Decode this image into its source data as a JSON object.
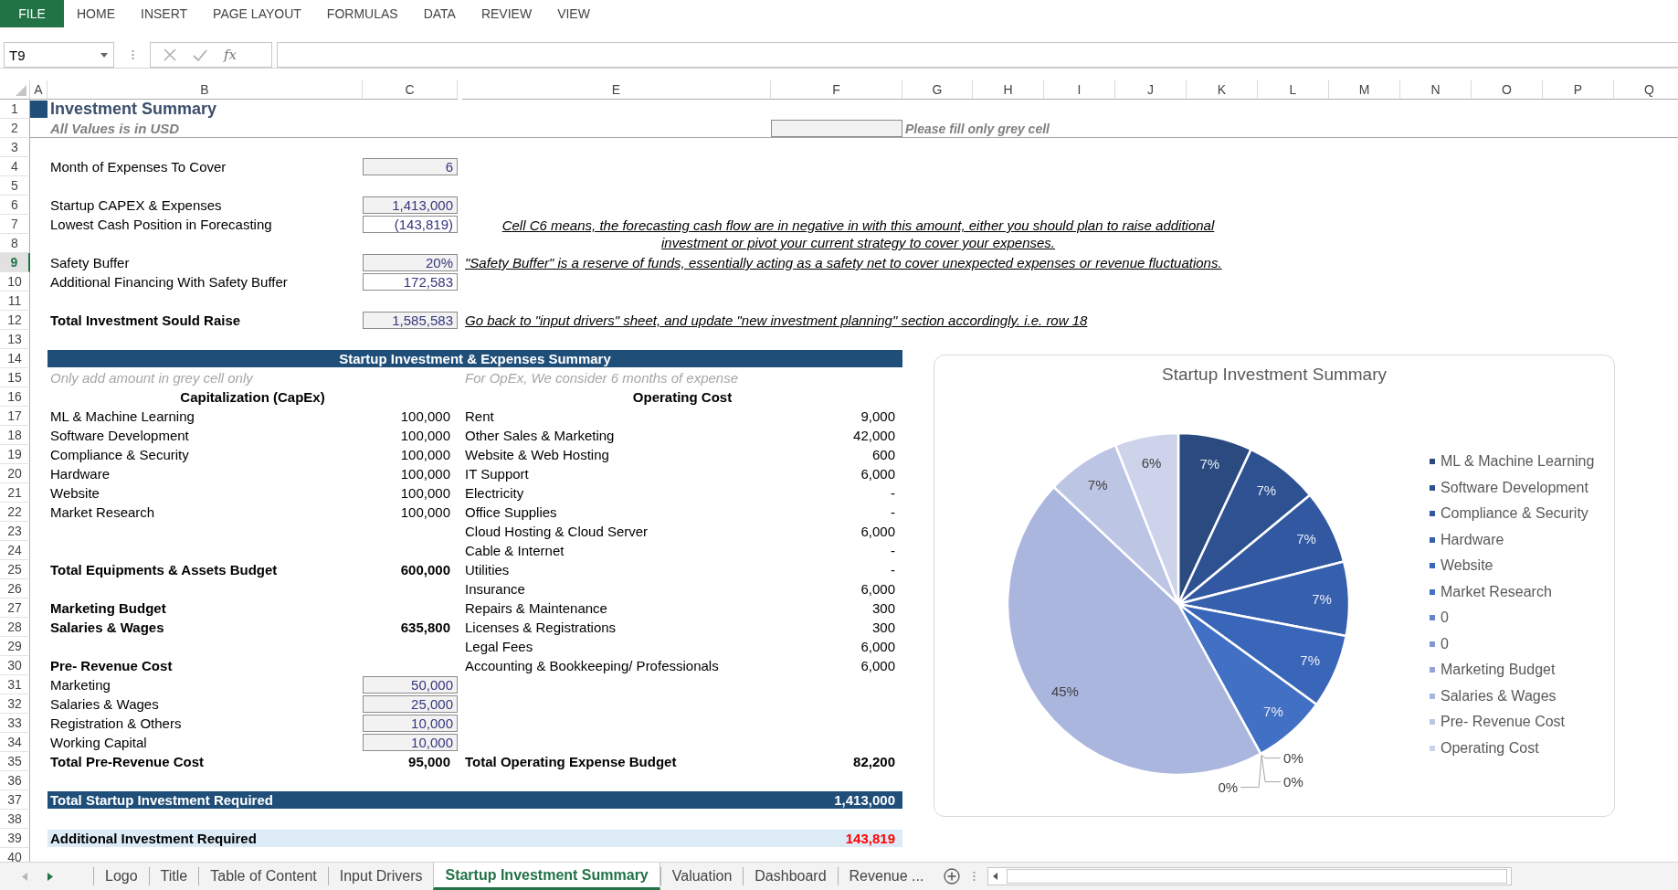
{
  "ribbon": {
    "file_tab": "FILE",
    "tabs": [
      "HOME",
      "INSERT",
      "PAGE LAYOUT",
      "FORMULAS",
      "DATA",
      "REVIEW",
      "VIEW"
    ]
  },
  "formula_bar": {
    "name_box": "T9",
    "function_label": "fx"
  },
  "column_headers": [
    "A",
    "B",
    "C",
    "E",
    "F",
    "G",
    "H",
    "I",
    "J",
    "K",
    "L",
    "M",
    "N",
    "O",
    "P",
    "Q"
  ],
  "rows": [
    {
      "header": "1",
      "selected": false,
      "title": "Investment Summary"
    },
    {
      "header": "2",
      "selected": false,
      "subtitle": "All Values is in USD",
      "legend": "Please fill only grey cell"
    },
    {
      "header": "3",
      "selected": false
    },
    {
      "header": "4",
      "selected": false,
      "field": {
        "label": "Month of Expenses To Cover",
        "value": "6",
        "kind": "input",
        "total": false
      }
    },
    {
      "header": "5",
      "selected": false
    },
    {
      "header": "6",
      "selected": false,
      "field": {
        "label": "Startup CAPEX & Expenses",
        "value": "1,413,000",
        "kind": "input",
        "total": false
      }
    },
    {
      "header": "7",
      "selected": false,
      "field": {
        "label": "Lowest Cash Position in Forecasting",
        "value": "(143,819)",
        "kind": "output",
        "total": false
      },
      "note": {
        "kind": "centered",
        "text": "Cell C6 means, the forecasting cash flow are in negative in with this amount, either you should plan to raise additional investment or pivot your current strategy to cover your expenses."
      }
    },
    {
      "header": "8",
      "selected": false
    },
    {
      "header": "9",
      "selected": true,
      "field": {
        "label": "Safety Buffer",
        "value": "20%",
        "kind": "input",
        "total": false
      },
      "note": {
        "kind": "inline",
        "text": "\"Safety Buffer\" is a reserve of funds, essentially acting as a safety net to cover unexpected expenses or revenue fluctuations."
      }
    },
    {
      "header": "10",
      "selected": false,
      "field": {
        "label": "Additional Financing With Safety Buffer",
        "value": "172,583",
        "kind": "output",
        "total": false
      }
    },
    {
      "header": "11",
      "selected": false
    },
    {
      "header": "12",
      "selected": false,
      "field": {
        "label": "Total Investment Sould Raise",
        "value": "1,585,583",
        "kind": "input",
        "total": true
      },
      "note": {
        "kind": "inline",
        "text": "Go back to \"input drivers\" sheet, and update \"new investment planning\" section accordingly. i.e. row 18"
      }
    },
    {
      "header": "13",
      "selected": false
    },
    {
      "header": "14",
      "selected": false,
      "banner": {
        "kind": "heading",
        "label": "Startup Investment & Expenses Summary"
      }
    },
    {
      "header": "15",
      "selected": false,
      "left": {
        "kind": "hint",
        "label": "Only add amount in grey cell only"
      },
      "right": {
        "kind": "hint",
        "label": "For OpEx, We consider 6 months of expense"
      }
    },
    {
      "header": "16",
      "selected": false,
      "left": {
        "kind": "heading",
        "label": "Capitalization (CapEx)"
      },
      "right": {
        "kind": "heading",
        "label": "Operating Cost"
      }
    },
    {
      "header": "17",
      "selected": false,
      "left": {
        "kind": "item",
        "label": "ML & Machine Learning",
        "amount": "100,000"
      },
      "right": {
        "kind": "item",
        "label": "Rent",
        "amount": "9,000"
      }
    },
    {
      "header": "18",
      "selected": false,
      "left": {
        "kind": "item",
        "label": "Software Development",
        "amount": "100,000"
      },
      "right": {
        "kind": "item",
        "label": "Other Sales & Marketing",
        "amount": "42,000"
      }
    },
    {
      "header": "19",
      "selected": false,
      "left": {
        "kind": "item",
        "label": "Compliance & Security",
        "amount": "100,000"
      },
      "right": {
        "kind": "item",
        "label": "Website & Web Hosting",
        "amount": "600"
      }
    },
    {
      "header": "20",
      "selected": false,
      "left": {
        "kind": "item",
        "label": "Hardware",
        "amount": "100,000"
      },
      "right": {
        "kind": "item",
        "label": "IT Support",
        "amount": "6,000"
      }
    },
    {
      "header": "21",
      "selected": false,
      "left": {
        "kind": "item",
        "label": "Website",
        "amount": "100,000"
      },
      "right": {
        "kind": "item",
        "label": "Electricity",
        "amount": "-"
      }
    },
    {
      "header": "22",
      "selected": false,
      "left": {
        "kind": "item",
        "label": "Market Research",
        "amount": "100,000"
      },
      "right": {
        "kind": "item",
        "label": "Office Supplies",
        "amount": "-"
      }
    },
    {
      "header": "23",
      "selected": false,
      "right": {
        "kind": "item",
        "label": "Cloud Hosting & Cloud Server",
        "amount": "6,000"
      }
    },
    {
      "header": "24",
      "selected": false,
      "right": {
        "kind": "item",
        "label": "Cable & Internet",
        "amount": "-"
      }
    },
    {
      "header": "25",
      "selected": false,
      "left": {
        "kind": "total",
        "label": "Total Equipments & Assets Budget",
        "amount": "600,000"
      },
      "right": {
        "kind": "item",
        "label": "Utilities",
        "amount": "-"
      }
    },
    {
      "header": "26",
      "selected": false,
      "right": {
        "kind": "item",
        "label": "Insurance",
        "amount": "6,000"
      }
    },
    {
      "header": "27",
      "selected": false,
      "left": {
        "kind": "total",
        "label": "Marketing Budget"
      },
      "right": {
        "kind": "item",
        "label": "Repairs & Maintenance",
        "amount": "300"
      }
    },
    {
      "header": "28",
      "selected": false,
      "left": {
        "kind": "total",
        "label": "Salaries & Wages",
        "amount": "635,800"
      },
      "right": {
        "kind": "item",
        "label": "Licenses & Registrations",
        "amount": "300"
      }
    },
    {
      "header": "29",
      "selected": false,
      "right": {
        "kind": "item",
        "label": "Legal Fees",
        "amount": "6,000"
      }
    },
    {
      "header": "30",
      "selected": false,
      "left": {
        "kind": "total",
        "label": "Pre- Revenue Cost"
      },
      "right": {
        "kind": "item",
        "label": "Accounting & Bookkeeping/ Professionals",
        "amount": "6,000"
      }
    },
    {
      "header": "31",
      "selected": false,
      "left": {
        "kind": "input",
        "label": "Marketing",
        "amount": "50,000"
      }
    },
    {
      "header": "32",
      "selected": false,
      "left": {
        "kind": "input",
        "label": "Salaries & Wages",
        "amount": "25,000"
      }
    },
    {
      "header": "33",
      "selected": false,
      "left": {
        "kind": "input",
        "label": "Registration & Others",
        "amount": "10,000"
      }
    },
    {
      "header": "34",
      "selected": false,
      "left": {
        "kind": "input",
        "label": "Working Capital",
        "amount": "10,000"
      }
    },
    {
      "header": "35",
      "selected": false,
      "left": {
        "kind": "total",
        "label": "Total Pre-Revenue Cost",
        "amount": "95,000"
      },
      "right": {
        "kind": "total",
        "label": "Total Operating Expense Budget",
        "amount": "82,200"
      }
    },
    {
      "header": "36",
      "selected": false
    },
    {
      "header": "37",
      "selected": false,
      "banner": {
        "kind": "total",
        "label": "Total Startup Investment Required",
        "value": "1,413,000"
      }
    },
    {
      "header": "38",
      "selected": false
    },
    {
      "header": "39",
      "selected": false,
      "banner": {
        "kind": "highlight",
        "label": "Additional Investment Required",
        "value": "143,819"
      }
    },
    {
      "header": "40",
      "selected": false
    }
  ],
  "chart": {
    "chart_data": {
      "type": "pie",
      "title": "Startup Investment Summary",
      "categories": [
        "ML & Machine Learning",
        "Software Development",
        "Compliance & Security",
        "Hardware",
        "Website",
        "Market Research",
        "0",
        "0",
        "Marketing Budget",
        "Salaries & Wages",
        "Pre- Revenue Cost",
        "Operating Cost"
      ],
      "values": [
        7,
        7,
        7,
        7,
        7,
        7,
        0,
        0,
        0,
        45,
        7,
        6
      ],
      "data_labels": true,
      "value_labels": [
        "7%",
        "7%",
        "7%",
        "7%",
        "7%",
        "7%",
        "0%",
        "0%",
        "0%",
        "45%",
        "7%",
        "6%"
      ],
      "legend": "right"
    }
  },
  "sheet_tabs": [
    {
      "label": "Logo",
      "selected": false
    },
    {
      "label": "Title",
      "selected": false
    },
    {
      "label": "Table of Content",
      "selected": false
    },
    {
      "label": "Input Drivers",
      "selected": false
    },
    {
      "label": "Startup Investment Summary",
      "selected": true
    },
    {
      "label": "Valuation",
      "selected": false
    },
    {
      "label": "Dashboard",
      "selected": false
    },
    {
      "label": "Revenue ...",
      "selected": false
    }
  ]
}
